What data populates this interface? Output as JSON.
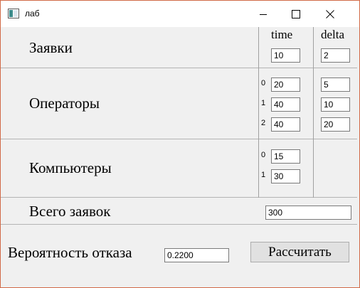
{
  "window": {
    "title": "лаб",
    "icon": "app-window-icon",
    "controls": [
      "minimize-icon",
      "maximize-icon",
      "close-icon"
    ]
  },
  "headers": {
    "time": "time",
    "delta": "delta"
  },
  "requests": {
    "label": "Заявки",
    "time": "10",
    "delta": "2"
  },
  "operators": {
    "label": "Операторы",
    "rows": [
      {
        "index": "0",
        "time": "20",
        "delta": "5"
      },
      {
        "index": "1",
        "time": "40",
        "delta": "10"
      },
      {
        "index": "2",
        "time": "40",
        "delta": "20"
      }
    ]
  },
  "computers": {
    "label": "Компьютеры",
    "rows": [
      {
        "index": "0",
        "time": "15"
      },
      {
        "index": "1",
        "time": "30"
      }
    ]
  },
  "total": {
    "label": "Всего заявок",
    "value": "300"
  },
  "failure": {
    "label": "Вероятность отказа",
    "value": "0.2200"
  },
  "calculate_button": "Рассчитать",
  "colors": {
    "border": "#d16a48",
    "background": "#f0f0f0"
  }
}
